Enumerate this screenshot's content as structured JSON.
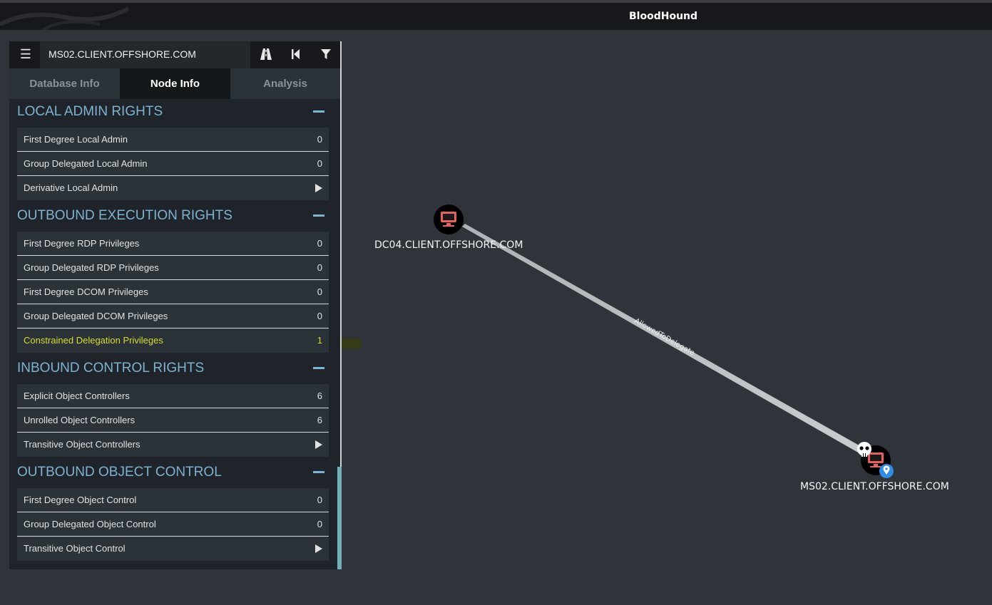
{
  "app": {
    "title": "BloodHound"
  },
  "search": {
    "node_name": "MS02.CLIENT.OFFSHORE.COM"
  },
  "toolbar": {
    "menu_icon": "hamburger-icon",
    "path_icon": "road-icon",
    "back_icon": "skip-back-icon",
    "filter_icon": "filter-icon"
  },
  "tabs": [
    {
      "label": "Database Info",
      "active": false
    },
    {
      "label": "Node Info",
      "active": true
    },
    {
      "label": "Analysis",
      "active": false
    }
  ],
  "sections": [
    {
      "title": "LOCAL ADMIN RIGHTS",
      "rows": [
        {
          "label": "First Degree Local Admin",
          "value": "0"
        },
        {
          "label": "Group Delegated Local Admin",
          "value": "0"
        },
        {
          "label": "Derivative Local Admin",
          "value": ""
        }
      ]
    },
    {
      "title": "OUTBOUND EXECUTION RIGHTS",
      "rows": [
        {
          "label": "First Degree RDP Privileges",
          "value": "0"
        },
        {
          "label": "Group Delegated RDP Privileges",
          "value": "0"
        },
        {
          "label": "First Degree DCOM Privileges",
          "value": "0"
        },
        {
          "label": "Group Delegated DCOM Privileges",
          "value": "0"
        },
        {
          "label": "Constrained Delegation Privileges",
          "value": "1"
        }
      ]
    },
    {
      "title": "INBOUND CONTROL RIGHTS",
      "rows": [
        {
          "label": "Explicit Object Controllers",
          "value": "6"
        },
        {
          "label": "Unrolled Object Controllers",
          "value": "6"
        },
        {
          "label": "Transitive Object Controllers",
          "value": ""
        }
      ]
    },
    {
      "title": "OUTBOUND OBJECT CONTROL",
      "rows": [
        {
          "label": "First Degree Object Control",
          "value": "0"
        },
        {
          "label": "Group Delegated Object Control",
          "value": "0"
        },
        {
          "label": "Transitive Object Control",
          "value": ""
        }
      ]
    }
  ],
  "graph": {
    "nodes": [
      {
        "label": "DC04.CLIENT.OFFSHORE.COM",
        "icon": "computer-icon"
      },
      {
        "label": "MS02.CLIENT.OFFSHORE.COM",
        "icon": "computer-icon",
        "badges": [
          "skull-icon",
          "location-pin-icon"
        ]
      }
    ],
    "edge": {
      "label": "AllowedToDelegate"
    }
  },
  "colors": {
    "background": "#2f343a",
    "section_header": "#7fb2cf",
    "highlight_text": "#d7dc2c",
    "node_fill": "#000000",
    "computer_icon": "#e8615f",
    "pin": "#2f8de4"
  }
}
